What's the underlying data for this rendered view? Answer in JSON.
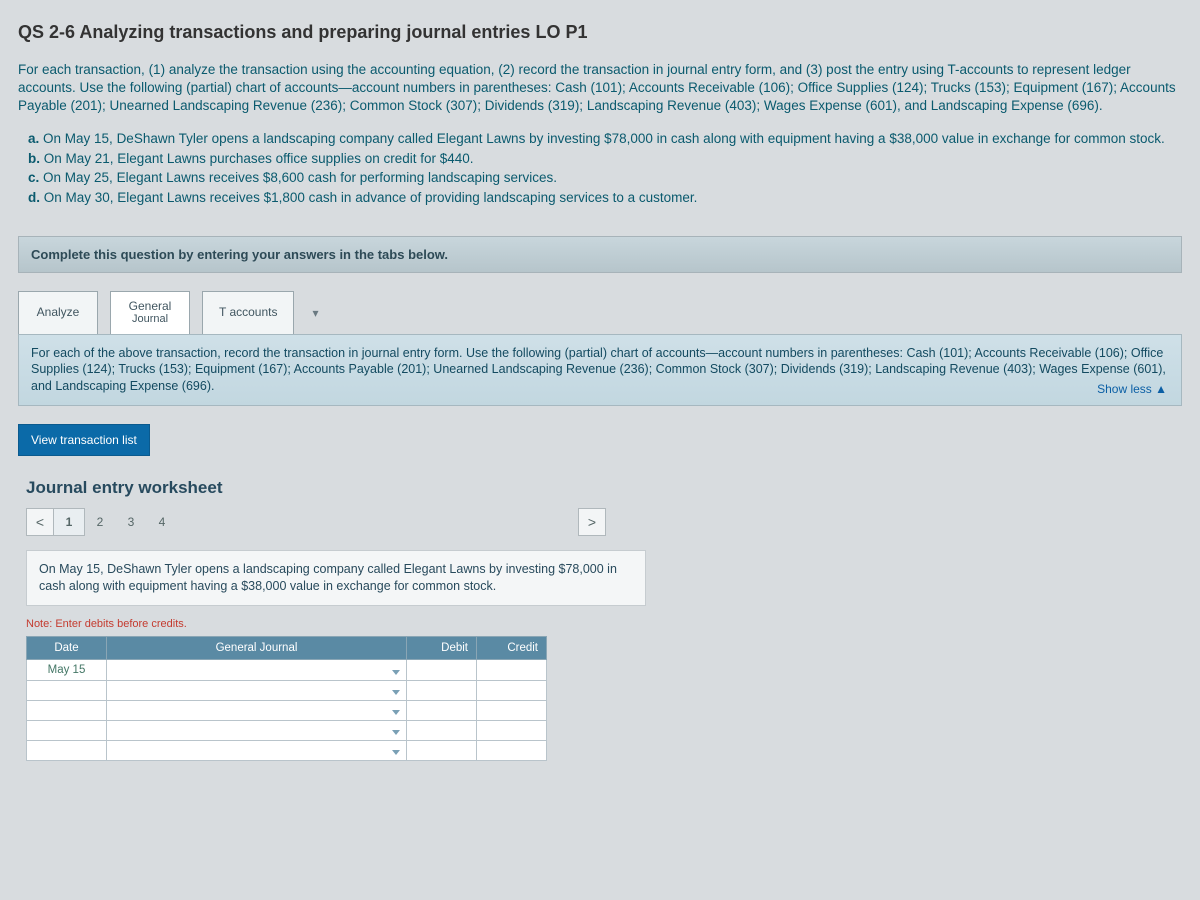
{
  "title": "QS 2-6 Analyzing transactions and preparing journal entries LO P1",
  "intro": "For each transaction, (1) analyze the transaction using the accounting equation, (2) record the transaction in journal entry form, and (3) post the entry using T-accounts to represent ledger accounts. Use the following (partial) chart of accounts—account numbers in parentheses: Cash (101); Accounts Receivable (106); Office Supplies (124); Trucks (153); Equipment (167); Accounts Payable (201); Unearned Landscaping Revenue (236); Common Stock (307); Dividends (319); Landscaping Revenue (403); Wages Expense (601), and Landscaping Expense (696).",
  "transactions": {
    "a_label": "a.",
    "a_text": "On May 15, DeShawn Tyler opens a landscaping company called Elegant Lawns by investing $78,000 in cash along with equipment having a $38,000 value in exchange for common stock.",
    "b_label": "b.",
    "b_text": "On May 21, Elegant Lawns purchases office supplies on credit for $440.",
    "c_label": "c.",
    "c_text": "On May 25, Elegant Lawns receives $8,600 cash for performing landscaping services.",
    "d_label": "d.",
    "d_text": "On May 30, Elegant Lawns receives $1,800 cash in advance of providing landscaping services to a customer."
  },
  "prompt_bar": "Complete this question by entering your answers in the tabs below.",
  "tabs": {
    "analyze": "Analyze",
    "gj_line1": "General",
    "gj_line2": "Journal",
    "taccounts": "T accounts"
  },
  "panel_text": "For each of the above transaction, record the transaction in journal entry form. Use the following (partial) chart of accounts—account numbers in parentheses: Cash (101); Accounts Receivable (106); Office Supplies (124); Trucks (153); Equipment (167); Accounts Payable (201); Unearned Landscaping Revenue (236); Common Stock (307); Dividends (319); Landscaping Revenue (403); Wages Expense (601), and Landscaping Expense (696).",
  "show_less": "Show less ▲",
  "view_btn": "View transaction list",
  "worksheet_title": "Journal entry worksheet",
  "pager": {
    "p1": "1",
    "p2": "2",
    "p3": "3",
    "p4": "4"
  },
  "desc_box": "On May 15, DeShawn Tyler opens a landscaping company called Elegant Lawns by investing $78,000 in cash along with equipment having a $38,000 value in exchange for common stock.",
  "note": "Note: Enter debits before credits.",
  "je_headers": {
    "date": "Date",
    "gj": "General Journal",
    "debit": "Debit",
    "credit": "Credit"
  },
  "je_date": "May 15"
}
